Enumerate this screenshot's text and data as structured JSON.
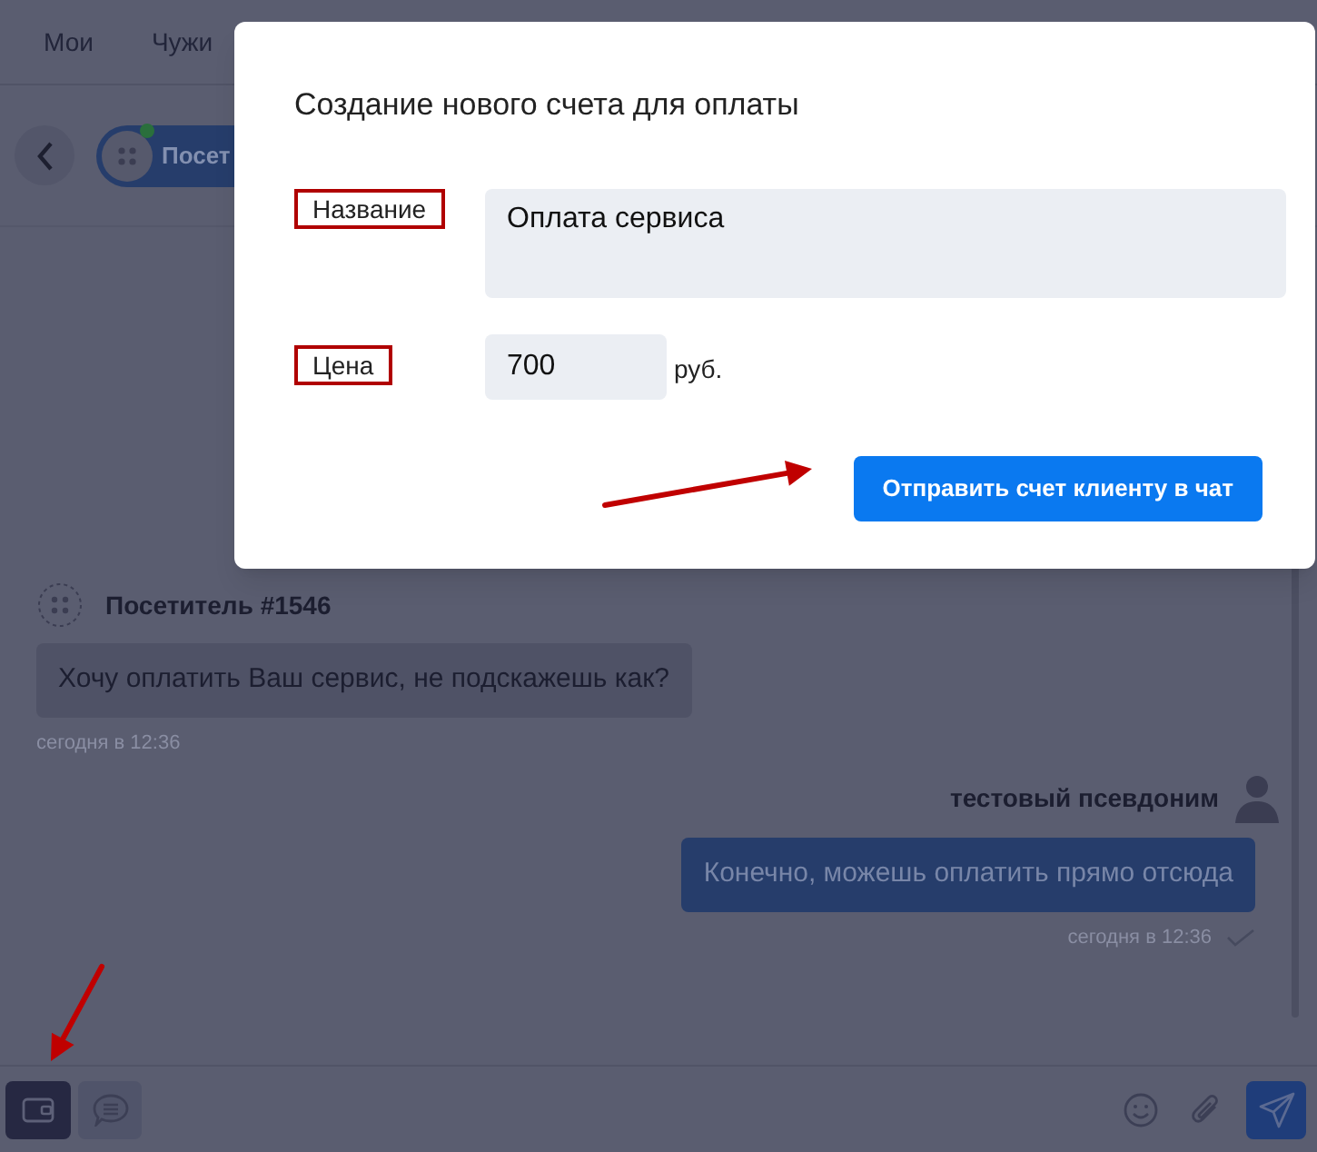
{
  "tabs": [
    {
      "label": "Мои"
    },
    {
      "label": "Чужи"
    }
  ],
  "chat_header": {
    "visitor": "Посет"
  },
  "messages": [
    {
      "kind": "incoming",
      "author": "Посетитель #1546",
      "text": "Хочу оплатить Ваш сервис, не подскажешь как?",
      "time": "сегодня в 12:36"
    },
    {
      "kind": "outgoing",
      "author": "тестовый псевдоним",
      "text": "Конечно, можешь оплатить прямо отсюда",
      "time": "сегодня в 12:36"
    }
  ],
  "dialog": {
    "title": "Создание нового счета для оплаты",
    "fields": [
      {
        "kind": "textarea",
        "label": "Название",
        "value": "Оплата сервиса"
      },
      {
        "kind": "price",
        "label": "Цена",
        "value": "700",
        "unit": "руб."
      }
    ],
    "submit": "Отправить счет клиенту в чат"
  }
}
